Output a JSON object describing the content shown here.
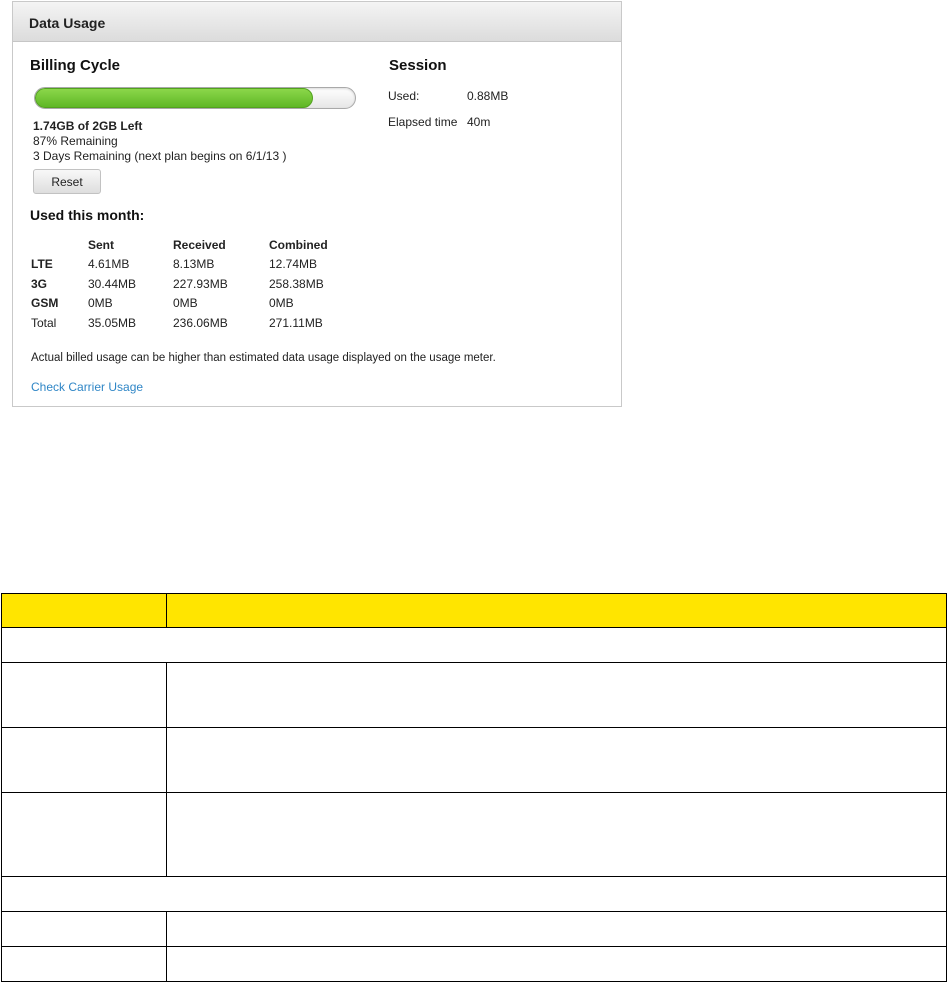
{
  "panel": {
    "title": "Data Usage",
    "billing_cycle": {
      "heading": "Billing Cycle",
      "progress_remaining_fraction": 0.87,
      "left_amount": "1.74",
      "left_rest": "GB of 2GB Left",
      "percent_remaining": "87% Remaining",
      "days_remaining": "3 Days Remaining (next plan begins on 6/1/13 )",
      "reset_label": "Reset"
    },
    "session": {
      "heading": "Session",
      "used_label": "Used:",
      "used_value": "0.88MB",
      "elapsed_label": "Elapsed time",
      "elapsed_value": "40m"
    },
    "used_month": {
      "heading": "Used this month:",
      "columns": [
        "",
        "Sent",
        "Received",
        "Combined"
      ],
      "rows": [
        [
          "LTE",
          "4.61MB",
          "8.13MB",
          "12.74MB"
        ],
        [
          "3G",
          "30.44MB",
          "227.93MB",
          "258.38MB"
        ],
        [
          "GSM",
          "0MB",
          "0MB",
          "0MB"
        ],
        [
          "Total",
          "35.05MB",
          "236.06MB",
          "271.11MB"
        ]
      ]
    },
    "note": "Actual billed usage can be higher than estimated data usage displayed on the usage meter.",
    "carrier_link": "Check Carrier Usage"
  },
  "colors": {
    "progress_green": "#6cc133",
    "link_blue": "#2f86c6",
    "table_header_yellow": "#ffe500"
  }
}
